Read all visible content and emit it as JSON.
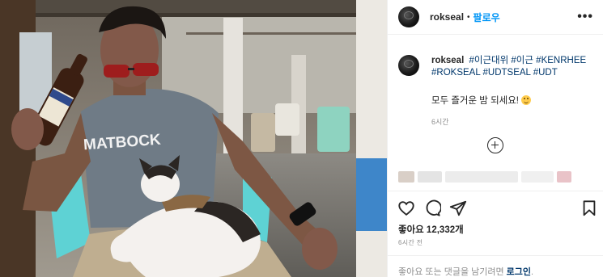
{
  "post": {
    "username": "rokseal",
    "follow_label": "팔로우",
    "dot": "•",
    "more": "•••",
    "shirt_text": "MATBOCK",
    "caption": {
      "username": "rokseal",
      "tags": [
        "#이근대위",
        "#이근",
        "#KENRHEE",
        "#ROKSEAL",
        "#UDTSEAL",
        "#UDT"
      ],
      "body": "모두 즐거운 밤 되세요!",
      "time": "6시간"
    },
    "likes_label": "좋아요 12,332개",
    "post_time": "6시간 전",
    "footer": {
      "text": "좋아요 또는 댓글을 남기려면 ",
      "login": "로그인",
      "end": "."
    }
  },
  "colors": {
    "follow": "#0095f6",
    "hashtag": "#00376b",
    "meta": "#8e8e8e"
  },
  "icons": [
    "more-options-icon",
    "load-more-comments-icon",
    "heart-icon",
    "comment-icon",
    "share-icon",
    "bookmark-icon",
    "smiley-emoji-icon"
  ]
}
